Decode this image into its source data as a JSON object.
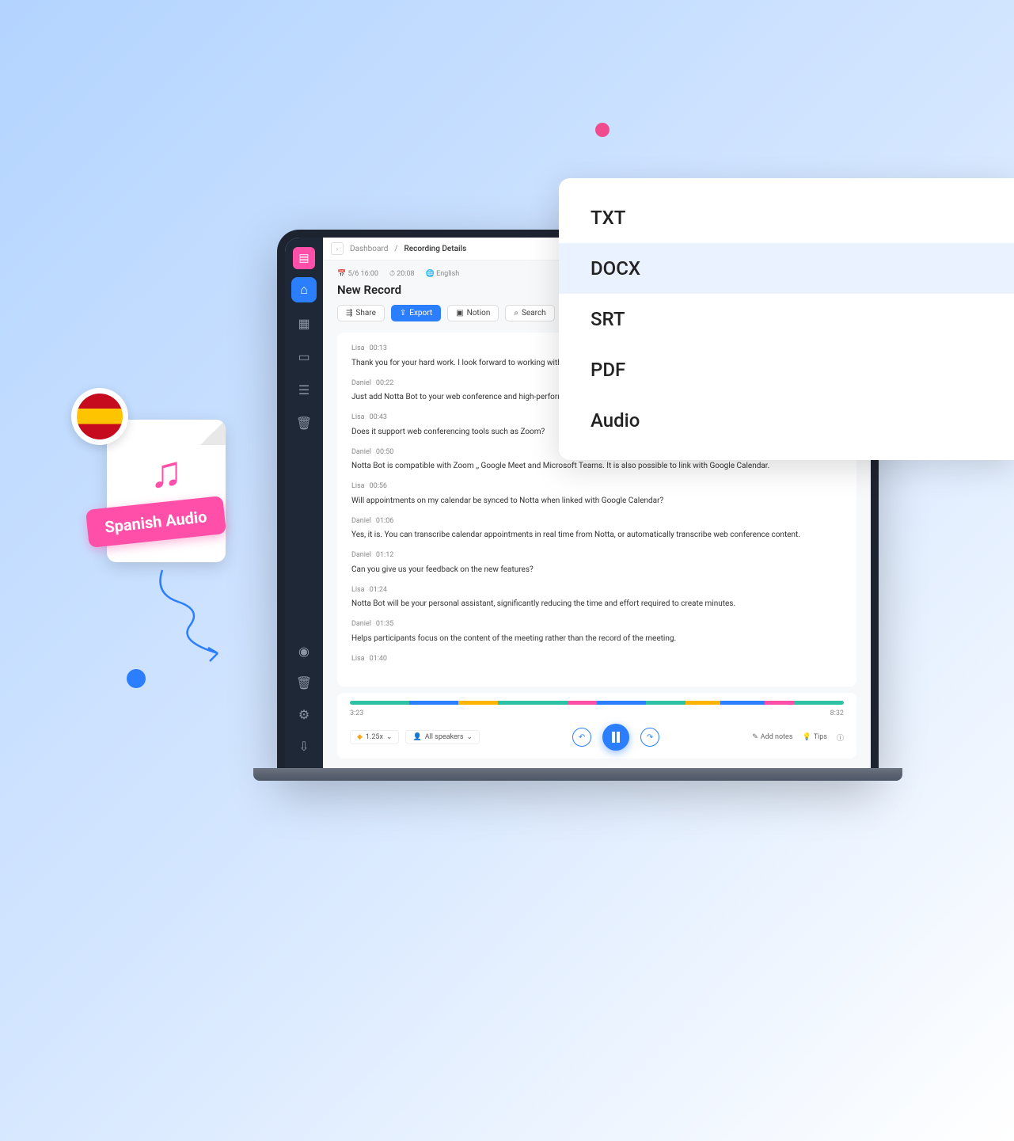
{
  "decor": {
    "audio_label": "Spanish Audio"
  },
  "breadcrumb": {
    "parent": "Dashboard",
    "current": "Recording Details"
  },
  "meta": {
    "date": "5/6 16:00",
    "duration": "20:08",
    "language": "English"
  },
  "record": {
    "title": "New Record"
  },
  "toolbar": {
    "share": "Share",
    "export": "Export",
    "notion": "Notion",
    "search": "Search"
  },
  "transcript": [
    {
      "speaker": "Lisa",
      "time": "00:13",
      "text": "Thank you for your hard work. I look forward to working with you"
    },
    {
      "speaker": "Daniel",
      "time": "00:22",
      "text": "Just add Notta Bot to your web conference and high-performance A"
    },
    {
      "speaker": "Lisa",
      "time": "00:43",
      "text": "Does it support web conferencing tools such as Zoom?"
    },
    {
      "speaker": "Daniel",
      "time": "00:50",
      "text": "Notta Bot is compatible with Zoom ,, Google Meet and Microsoft Teams. It is also possible to link with Google Calendar."
    },
    {
      "speaker": "Lisa",
      "time": "00:56",
      "text": "Will appointments on my calendar be synced to Notta when linked with Google Calendar?"
    },
    {
      "speaker": "Daniel",
      "time": "01:06",
      "text": "Yes, it is. You can transcribe calendar appointments in real time from Notta, or automatically transcribe web conference content."
    },
    {
      "speaker": "Daniel",
      "time": "01:12",
      "text": "Can you give us your feedback on the new features?"
    },
    {
      "speaker": "Lisa",
      "time": "01:24",
      "text": "Notta Bot will be your personal assistant, significantly reducing the time and effort required to create minutes."
    },
    {
      "speaker": "Daniel",
      "time": "01:35",
      "text": "Helps participants focus on the content of the meeting rather than the record of the meeting."
    },
    {
      "speaker": "Lisa",
      "time": "01:40",
      "text": ""
    }
  ],
  "player": {
    "elapsed": "3:23",
    "total": "8:32",
    "speed": "1.25x",
    "speakers": "All speakers",
    "add_notes": "Add notes",
    "tips": "Tips",
    "segments": [
      {
        "color": "#2dc2a3",
        "width": 12
      },
      {
        "color": "#2b7fff",
        "width": 10
      },
      {
        "color": "#ffb400",
        "width": 8
      },
      {
        "color": "#2dc2a3",
        "width": 14
      },
      {
        "color": "#ff4fa8",
        "width": 6
      },
      {
        "color": "#2b7fff",
        "width": 10
      },
      {
        "color": "#2dc2a3",
        "width": 8
      },
      {
        "color": "#ffb400",
        "width": 7
      },
      {
        "color": "#2b7fff",
        "width": 9
      },
      {
        "color": "#ff4fa8",
        "width": 6
      },
      {
        "color": "#2dc2a3",
        "width": 10
      }
    ]
  },
  "export_menu": {
    "items": [
      "TXT",
      "DOCX",
      "SRT",
      "PDF",
      "Audio"
    ],
    "highlighted": "DOCX"
  }
}
